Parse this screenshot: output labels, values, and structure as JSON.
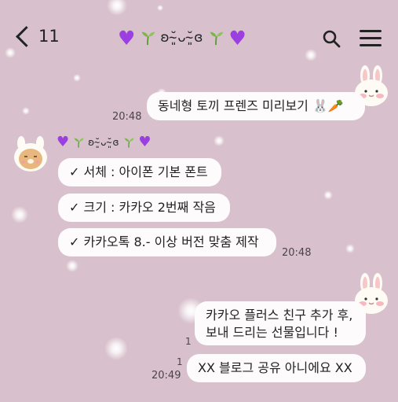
{
  "header": {
    "back_count": "11",
    "title_text": "ʚ˘̴͈ᴗ˘̴͈ɞ"
  },
  "messages": {
    "m1": {
      "text": "동네형 토끼 프렌즈 미리보기 🐰🥕",
      "time": "20:48"
    },
    "sender_name": "ʚ˘̴͈ᴗ˘̴͈ɞ",
    "m2": {
      "text": "✓ 서체 : 아이폰 기본 폰트"
    },
    "m3": {
      "text": "✓ 크기 : 카카오 2번째 작음"
    },
    "m4": {
      "text": "✓ 카카오톡 8.- 이상 버전 맞춤 제작",
      "time": "20:48"
    },
    "m5": {
      "line1": "카카오 플러스 친구 추가 후,",
      "line2": "보내 드리는 선물입니다 !",
      "unread": "1"
    },
    "m6": {
      "text": "XX 블로그 공유 아니에요 XX",
      "unread": "1",
      "time": "20:49"
    }
  },
  "colors": {
    "background": "#d8c1cc",
    "bubble": "#fdfbfc",
    "heart": "#9b3fe0",
    "sprout": "#7ab648"
  }
}
